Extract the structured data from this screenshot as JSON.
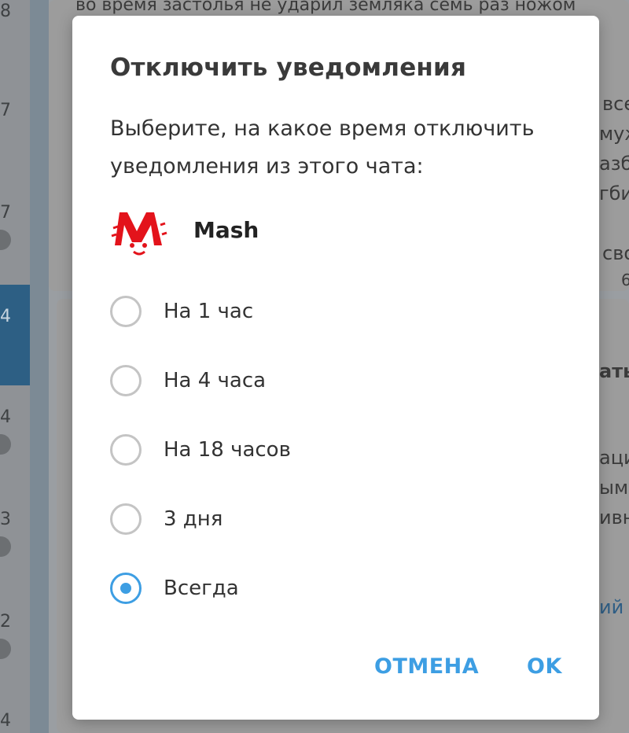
{
  "background": {
    "left_numbers": [
      "8",
      "7",
      "7",
      "4",
      "4",
      "3",
      "2",
      "4"
    ],
    "top_text": "во время застолья не ударил земляка семь раз ножом",
    "right_fragments": [
      "все",
      "муж",
      "азб",
      "гби",
      "сво",
      "6",
      "ать",
      "ацие",
      "ым",
      "ивн",
      "ий м"
    ]
  },
  "dialog": {
    "title": "Отключить уведомления",
    "description": "Выберите, на какое время отключить уведомления из этого чата:",
    "chat": {
      "name": "Mash",
      "logo_icon": "mash-logo"
    },
    "options": [
      {
        "label": "На 1 час",
        "checked": false
      },
      {
        "label": "На 4 часа",
        "checked": false
      },
      {
        "label": "На 18 часов",
        "checked": false
      },
      {
        "label": "3 дня",
        "checked": false
      },
      {
        "label": "Всегда",
        "checked": true
      }
    ],
    "cancel_label": "ОТМЕНА",
    "ok_label": "OK"
  },
  "colors": {
    "accent": "#3d9ee3",
    "radio_border": "#c4c4c4",
    "logo_red": "#e3131b",
    "overlay_bg": "#9a9ea2"
  }
}
